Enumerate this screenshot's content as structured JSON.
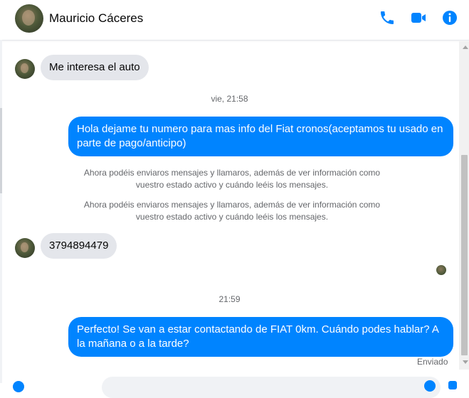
{
  "header": {
    "contact_name": "Mauricio Cáceres",
    "icons": [
      "phone-icon",
      "video-camera-icon",
      "info-icon"
    ],
    "accent_color": "#0084ff"
  },
  "messages": {
    "m1": "Me interesa el auto",
    "ts1": "vie, 21:58",
    "m2": "Hola dejame tu numero para mas info del Fiat cronos(aceptamos tu usado en parte de pago/anticipo)",
    "sys1": "Ahora podéis enviaros mensajes y llamaros, además de ver información como vuestro estado activo y cuándo leéis los mensajes.",
    "sys2": "Ahora podéis enviaros mensajes y llamaros, además de ver información como vuestro estado activo y cuándo leéis los mensajes.",
    "m3": "3794894479",
    "ts2": "21:59",
    "m4": "Perfecto!  Se van a estar contactando de FIAT 0km. Cuándo podes hablar? A la mañana o a la tarde?",
    "status": "Enviado"
  },
  "colors": {
    "outgoing_bubble": "#0084ff",
    "incoming_bubble": "#e4e6eb"
  }
}
